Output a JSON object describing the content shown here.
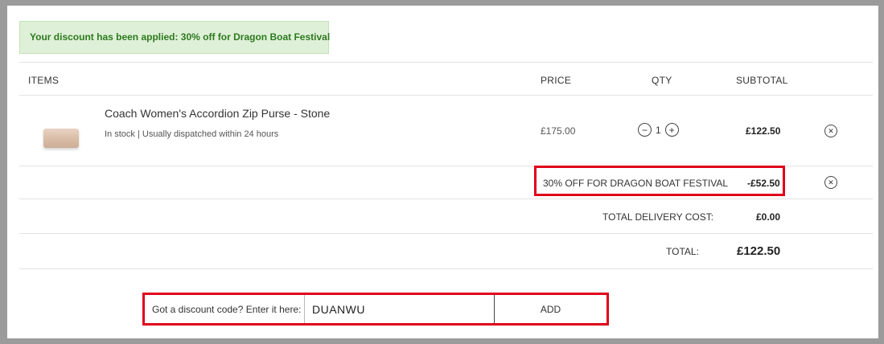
{
  "banner": {
    "message": "Your discount has been applied: 30% off for Dragon Boat Festival"
  },
  "table": {
    "headers": {
      "items": "ITEMS",
      "price": "PRICE",
      "qty": "QTY",
      "subtotal": "SUBTOTAL"
    }
  },
  "cart_items": [
    {
      "name": "Coach Women's Accordion Zip Purse - Stone",
      "stock": "In stock | Usually dispatched within 24 hours",
      "price": "£175.00",
      "qty": "1",
      "subtotal": "£122.50",
      "minus": "−",
      "plus": "+",
      "remove": "✕"
    }
  ],
  "discount": {
    "label": "30% OFF FOR DRAGON BOAT FESTIVAL",
    "amount": "-£52.50",
    "remove": "✕"
  },
  "delivery": {
    "label": "TOTAL DELIVERY COST:",
    "value": "£0.00"
  },
  "total": {
    "label": "TOTAL:",
    "value": "£122.50"
  },
  "discount_form": {
    "label": "Got a discount code? Enter it here:",
    "code_value": "DUANWU",
    "add_label": "ADD"
  },
  "colors": {
    "highlight": "#e0001b",
    "banner_bg": "#dff0d8",
    "banner_text": "#2d7a1f"
  },
  "icons": {
    "minus": "minus-circle-icon",
    "plus": "plus-circle-icon",
    "remove": "close-circle-icon"
  }
}
